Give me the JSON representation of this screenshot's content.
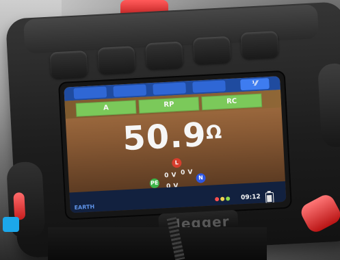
{
  "meter": {
    "top_tabs": [
      "",
      "",
      "",
      "",
      "⅟⁄"
    ],
    "test_labels": [
      "A",
      "RP",
      "RC"
    ],
    "reading": {
      "value": "50.9",
      "unit": "Ω"
    },
    "mode_label": "EARTH",
    "probe_labels": {
      "l": "L",
      "pe": "PE",
      "n": "N",
      "v1": "0 V",
      "v2": "0 V",
      "v3": "0 V"
    },
    "time": "09:12",
    "brand": "Megger"
  },
  "colors": {
    "screen_bg": "#8a5b35",
    "highlight_blue": "#2f67d5",
    "test_green": "#7bc95a"
  }
}
